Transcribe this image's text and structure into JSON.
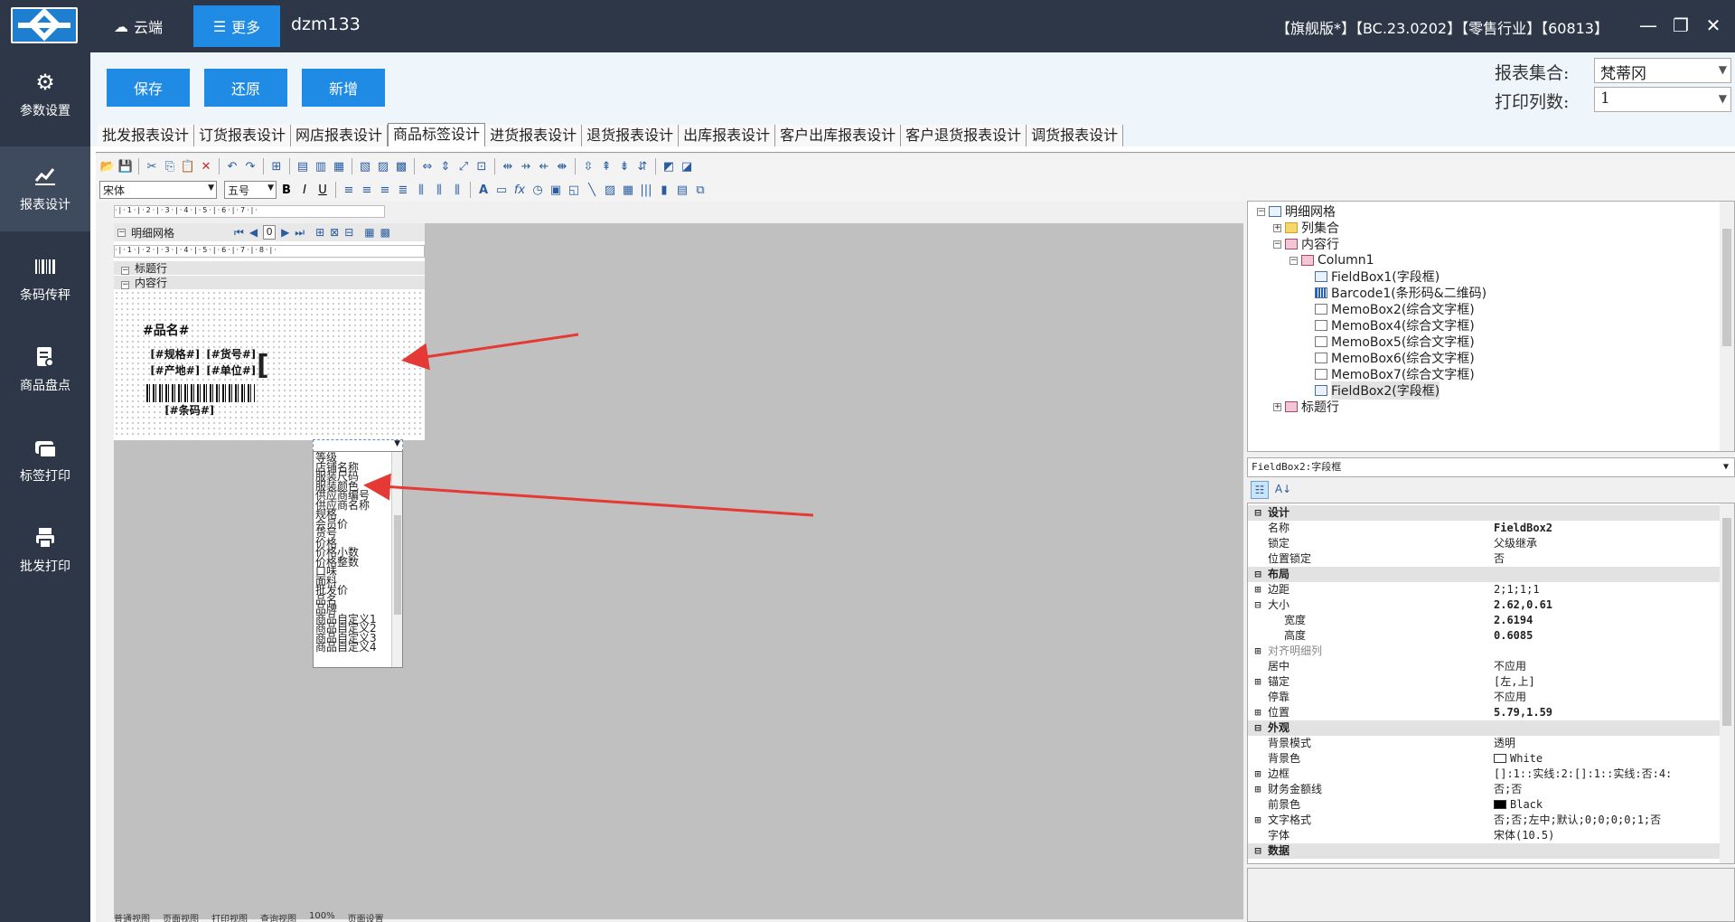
{
  "topbar": {
    "cloud_label": "云端",
    "more_label": "更多",
    "username": "dzm133",
    "edition": "【旗舰版*】【BC.23.0202】【零售行业】【60813】"
  },
  "nav": {
    "items": [
      {
        "label": "参数设置",
        "icon": "gear-icon"
      },
      {
        "label": "报表设计",
        "icon": "chart-icon"
      },
      {
        "label": "条码传秤",
        "icon": "barcode-icon"
      },
      {
        "label": "商品盘点",
        "icon": "inventory-icon"
      },
      {
        "label": "标签打印",
        "icon": "label-icon"
      },
      {
        "label": "批发打印",
        "icon": "printer-icon"
      }
    ]
  },
  "actions": {
    "save": "保存",
    "restore": "还原",
    "add": "新增"
  },
  "report_set": {
    "label": "报表集合:",
    "value": "梵蒂冈"
  },
  "print_cols": {
    "label": "打印列数:",
    "value": "1"
  },
  "tabs": [
    "批发报表设计",
    "订货报表设计",
    "网店报表设计",
    "商品标签设计",
    "进货报表设计",
    "退货报表设计",
    "出库报表设计",
    "客户出库报表设计",
    "客户退货报表设计",
    "调货报表设计"
  ],
  "active_tab": "商品标签设计",
  "format": {
    "font": "宋体",
    "size": "五号"
  },
  "grid": {
    "title": "明细网格",
    "page_value": "0",
    "band_title": "标题行",
    "band_content": "内容行"
  },
  "label_fields": {
    "name": "#品名#",
    "spec": "[#规格#]",
    "itemno": "[#货号#]",
    "origin": "[#产地#]",
    "unit": "[#单位#]",
    "barcode": "[#条码#]"
  },
  "dropdown_options": [
    "等级",
    "店铺名称",
    "服装尺码",
    "服装颜色",
    "供应商编号",
    "供应商名称",
    "规格",
    "会员价",
    "货号",
    "价格",
    "价格小数",
    "价格整数",
    "口味",
    "面料",
    "批发价",
    "品名",
    "品牌",
    "商品自定义1",
    "商品自定义2",
    "商品自定义3",
    "商品自定义4"
  ],
  "tree": {
    "root": "明细网格",
    "columns": "列集合",
    "content_row": "内容行",
    "column1": "Column1",
    "children": [
      "FieldBox1(字段框)",
      "Barcode1(条形码&二维码)",
      "MemoBox2(综合文字框)",
      "MemoBox4(综合文字框)",
      "MemoBox5(综合文字框)",
      "MemoBox6(综合文字框)",
      "MemoBox7(综合文字框)",
      "FieldBox2(字段框)"
    ],
    "next": "标题行"
  },
  "props": {
    "header": "FieldBox2:字段框",
    "rows": [
      {
        "type": "cat",
        "name": "设计",
        "value": ""
      },
      {
        "type": "row",
        "name": "名称",
        "value": "FieldBox2"
      },
      {
        "type": "row",
        "name": "锁定",
        "value": "父级继承"
      },
      {
        "type": "row",
        "name": "位置锁定",
        "value": "否"
      },
      {
        "type": "cat",
        "name": "布局",
        "value": ""
      },
      {
        "type": "exp",
        "name": "边距",
        "value": "2;1;1;1"
      },
      {
        "type": "col",
        "name": "大小",
        "value": "2.62,0.61"
      },
      {
        "type": "sub",
        "name": "宽度",
        "value": "2.6194"
      },
      {
        "type": "sub",
        "name": "高度",
        "value": "0.6085"
      },
      {
        "type": "exp",
        "name": "对齐明细列",
        "value": ""
      },
      {
        "type": "row",
        "name": "居中",
        "value": "不应用"
      },
      {
        "type": "exp",
        "name": "锚定",
        "value": "[左,上]"
      },
      {
        "type": "row",
        "name": "停靠",
        "value": "不应用"
      },
      {
        "type": "exp",
        "name": "位置",
        "value": "5.79,1.59"
      },
      {
        "type": "cat",
        "name": "外观",
        "value": ""
      },
      {
        "type": "row",
        "name": "背景模式",
        "value": "透明"
      },
      {
        "type": "row",
        "name": "背景色",
        "value": "White"
      },
      {
        "type": "exp",
        "name": "边框",
        "value": "[]:1::实线:2:[]:1::实线:否:4:"
      },
      {
        "type": "exp",
        "name": "财务金额线",
        "value": "否;否"
      },
      {
        "type": "row",
        "name": "前景色",
        "value": "Black"
      },
      {
        "type": "exp",
        "name": "文字格式",
        "value": "否;否;左中;默认;0;0;0;0;1;否"
      },
      {
        "type": "row",
        "name": "字体",
        "value": "宋体(10.5)"
      },
      {
        "type": "cat",
        "name": "数据",
        "value": ""
      }
    ]
  },
  "bottom_tabs": [
    "普通视图",
    "页面视图",
    "打印视图",
    "查询视图",
    "100%",
    "页面设置"
  ],
  "colors": {
    "nav_bg": "#2d3748",
    "accent": "#1f8be4",
    "arrow": "#e53935"
  }
}
